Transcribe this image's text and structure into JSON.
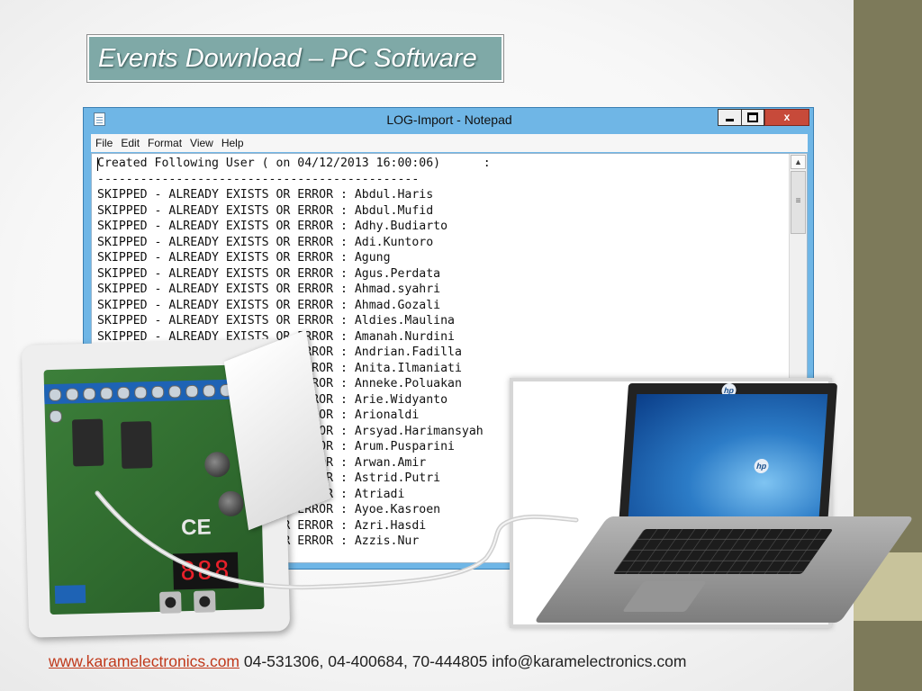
{
  "slide": {
    "title": "Events Download – PC Software"
  },
  "notepad": {
    "title": "LOG-Import - Notepad",
    "close_glyph": "x",
    "menu": [
      "File",
      "Edit",
      "Format",
      "View",
      "Help"
    ],
    "lines": [
      "Created Following User ( on 04/12/2013 16:00:06)      :",
      "---------------------------------------------",
      "SKIPPED - ALREADY EXISTS OR ERROR : Abdul.Haris",
      "SKIPPED - ALREADY EXISTS OR ERROR : Abdul.Mufid",
      "SKIPPED - ALREADY EXISTS OR ERROR : Adhy.Budiarto",
      "SKIPPED - ALREADY EXISTS OR ERROR : Adi.Kuntoro",
      "SKIPPED - ALREADY EXISTS OR ERROR : Agung",
      "SKIPPED - ALREADY EXISTS OR ERROR : Agus.Perdata",
      "SKIPPED - ALREADY EXISTS OR ERROR : Ahmad.syahri",
      "SKIPPED - ALREADY EXISTS OR ERROR : Ahmad.Gozali",
      "SKIPPED - ALREADY EXISTS OR ERROR : Aldies.Maulina",
      "SKIPPED - ALREADY EXISTS OR ERROR : Amanah.Nurdini",
      "SKIPPED - ALREADY EXISTS OR ERROR : Andrian.Fadilla",
      "SKIPPED - ALREADY EXISTS OR ERROR : Anita.Ilmaniati",
      "SKIPPED - ALREADY EXISTS OR ERROR : Anneke.Poluakan",
      "SKIPPED - ALREADY EXISTS OR ERROR : Arie.Widyanto",
      "SKIPPED - ALREADY EXISTS OR ERROR : Arionaldi",
      "SKIPPED - ALREADY EXISTS OR ERROR : Arsyad.Harimansyah",
      "SKIPPED - ALREADY EXISTS OR ERROR : Arum.Pusparini",
      "SKIPPED - ALREADY EXISTS OR ERROR : Arwan.Amir",
      "SKIPPED - ALREADY EXISTS OR ERROR : Astrid.Putri",
      "SKIPPED - ALREADY EXISTS OR ERROR : Atriadi",
      "SKIPPED - ALREADY EXISTS OR ERROR : Ayoe.Kasroen",
      "SKIPPED - ALREADY EXISTS OR ERROR : Azri.Hasdi",
      "SKIPPED - ALREADY EXISTS OR ERROR : Azzis.Nur"
    ]
  },
  "device": {
    "display": "888"
  },
  "laptop": {
    "logo": "hp"
  },
  "footer": {
    "website": "www.karamelectronics.com",
    "contact": " 04-531306, 04-400684, 70-444805 info@karamelectronics.com"
  },
  "colors": {
    "title_box": "#7fa9a7",
    "side_bar": "#7d7a5a",
    "side_accent": "#c8c39b",
    "link": "#c0391b",
    "window_frame": "#6fb6e6",
    "close_button": "#c74a3a"
  }
}
